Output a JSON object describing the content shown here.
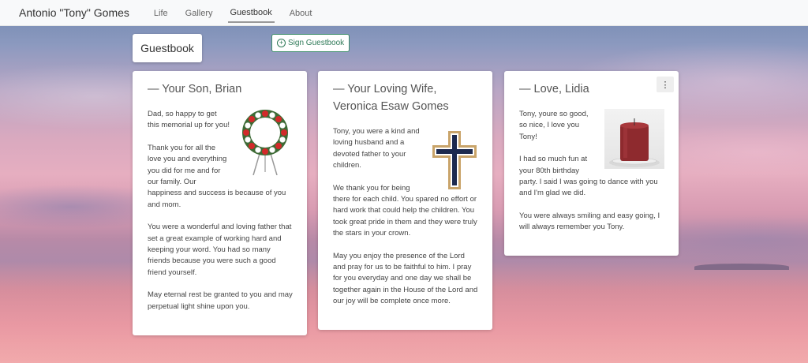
{
  "navbar": {
    "brand": "Antonio \"Tony\" Gomes",
    "links": [
      {
        "label": "Life"
      },
      {
        "label": "Gallery"
      },
      {
        "label": "Guestbook"
      },
      {
        "label": "About"
      }
    ],
    "active": "Guestbook"
  },
  "guestbook": {
    "title": "Guestbook",
    "sign_label": "Sign Guestbook"
  },
  "entries": [
    {
      "author": "— Your Son, Brian",
      "image_icon": "wreath-image",
      "paragraphs": [
        "Dad, so happy to get this memorial up for you!",
        "Thank you for all the love you and everything you did for me and for our family. Our happiness and success is because of you and mom.",
        "You were a wonderful and loving father that set a great example of working hard and keeping your word. You had so many friends because you were such a good friend yourself.",
        "May eternal rest be granted to you and may perpetual light shine upon you."
      ]
    },
    {
      "author": "— Your Loving Wife, Veronica Esaw Gomes",
      "image_icon": "cross-image",
      "paragraphs": [
        "Tony, you were a kind and loving husband and a devoted father to your children.",
        "We thank you for being there for each child. You spared no effort or hard work that could help the children. You took great pride in them and they were truly the stars in your crown.",
        "May you enjoy the presence of the Lord and pray for us to be faithful to him. I pray for you everyday and one day we shall be together again in the House of the Lord and our joy will be complete once more."
      ]
    },
    {
      "author": "— Love, Lidia",
      "image_icon": "candle-image",
      "menu_icon": "more-vertical-icon",
      "paragraphs": [
        "Tony, youre so good, so nice, I love you Tony!",
        "I had so much fun at your 80th birthday party. I said I was going to dance with you and I'm glad we did.",
        "You were always smiling and easy going, I will always remember you Tony."
      ]
    }
  ],
  "colors": {
    "accent_green": "#2f7a58",
    "cross_navy": "#1d2a4f",
    "cross_gold": "#c9a46a",
    "candle_red": "#8e2a2e"
  }
}
